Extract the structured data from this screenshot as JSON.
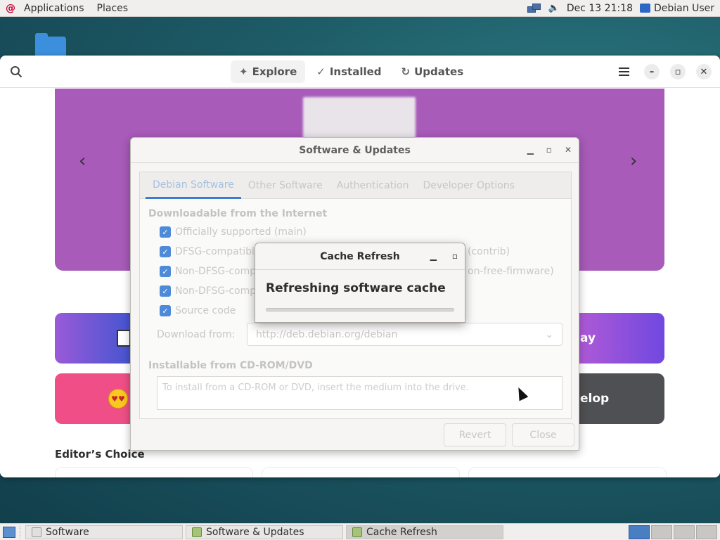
{
  "top_panel": {
    "applications": "Applications",
    "places": "Places",
    "datetime": "Dec 13  21:18",
    "user": "Debian User"
  },
  "software": {
    "tabs": [
      {
        "label": "Explore",
        "icon": "✦"
      },
      {
        "label": "Installed",
        "icon": "✓"
      },
      {
        "label": "Updates",
        "icon": "↻"
      }
    ],
    "tile_play": "ay",
    "tile_develop": "elop",
    "editors_choice": "Editor’s Choice"
  },
  "sources_dialog": {
    "title": "Software & Updates",
    "tabs": [
      "Debian Software",
      "Other Software",
      "Authentication",
      "Developer Options"
    ],
    "section_internet": "Downloadable from the Internet",
    "checks": [
      "Officially supported (main)",
      "DFSG-compatibl",
      "Non-DFSG-comp",
      "Non-DFSG-comp",
      "Source code"
    ],
    "check_tail_1": "(contrib)",
    "check_tail_2": "on-free-firmware)",
    "download_from_label": "Download from:",
    "download_from_value": "http://deb.debian.org/debian",
    "section_cdrom": "Installable from CD-ROM/DVD",
    "cdrom_hint": "To install from a CD-ROM or DVD, insert the medium into the drive.",
    "revert": "Revert",
    "close": "Close"
  },
  "cache_dialog": {
    "title": "Cache Refresh",
    "message": "Refreshing software cache",
    "progress": 0.0
  },
  "taskbar": {
    "items": [
      "Software",
      "Software & Updates",
      "Cache Refresh"
    ]
  },
  "colors": {
    "accent": "#3a7bd6",
    "banner": "#a85bb9"
  }
}
